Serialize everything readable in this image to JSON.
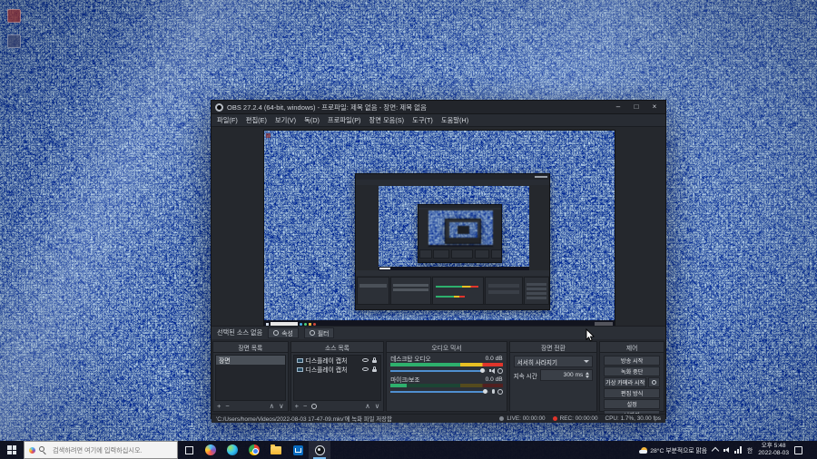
{
  "obs": {
    "window_title": "OBS 27.2.4 (64-bit, windows) - 프로파일: 제목 없음 - 장면: 제목 없음",
    "window_buttons": {
      "minimize": "–",
      "maximize": "□",
      "close": "×"
    },
    "menu": [
      "파일(F)",
      "편집(E)",
      "보기(V)",
      "독(D)",
      "프로파일(P)",
      "장면 모음(S)",
      "도구(T)",
      "도움말(H)"
    ],
    "source_toolbar": {
      "message": "선택된 소스 없음",
      "properties": "속성",
      "filters": "필터"
    },
    "scenes": {
      "title": "장면 목록",
      "items": [
        "장면"
      ]
    },
    "sources": {
      "title": "소스 목록",
      "items": [
        "디스플레이 캡처",
        "디스플레이 캡처"
      ]
    },
    "mixer": {
      "title": "오디오 믹서",
      "channels": [
        {
          "name": "데스크탑 오디오",
          "volume": "0.0 dB"
        },
        {
          "name": "마이크/보조",
          "volume": "0.0 dB"
        }
      ]
    },
    "transitions": {
      "title": "장면 전환",
      "selected": "서서히 사라지기",
      "duration_label": "지속 시간",
      "duration_value": "300 ms"
    },
    "controls": {
      "title": "제어",
      "stream": "방송 시작",
      "record": "녹화 중단",
      "virtual_camera": "가상 카메라 시작",
      "studio_mode": "편집 방식",
      "settings": "설정",
      "exit": "나가기"
    },
    "statusbar": {
      "message": "'C:/Users/home/Videos/2022-08-03 17-47-09.mkv'에 녹화 파일 저장함",
      "live_label": "LIVE: 00:00:00",
      "rec_label": "REC: 00:00:00",
      "perf": "CPU: 1.7%, 30.00 fps"
    },
    "glyphs": {
      "plus": "+",
      "minus": "−",
      "up": "∧",
      "down": "∨"
    }
  },
  "taskbar": {
    "search_placeholder": "검색하려면 여기에 입력하십시오.",
    "weather": "28°C 부분적으로 맑음",
    "ime": "한",
    "time": "오후 5:48",
    "date": "2022-08-03"
  },
  "colors": {
    "accent_blue": "#4f8fd0",
    "meter_green": "#2eb06d",
    "meter_yellow": "#e8c023",
    "meter_red": "#e0352b",
    "rec_red": "#e0352b",
    "desktop_blue": "#0e2a55"
  }
}
